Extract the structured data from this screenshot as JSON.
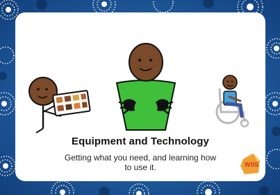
{
  "card": {
    "title": "Equipment and Technology",
    "subtitle": "Getting what you need, and learning how to use it."
  },
  "logo": {
    "text": "WIIS"
  },
  "colors": {
    "background": "#1f5ea8",
    "card": "#ffffff",
    "shirt": "#3fbf3a",
    "skin": "#7a4a2a",
    "logo_orange": "#f0a030",
    "logo_red": "#d0312d"
  },
  "icons": [
    "person-holding-tablet-icon",
    "person-signing-icon",
    "person-in-wheelchair-icon",
    "wiis-logo-icon"
  ]
}
